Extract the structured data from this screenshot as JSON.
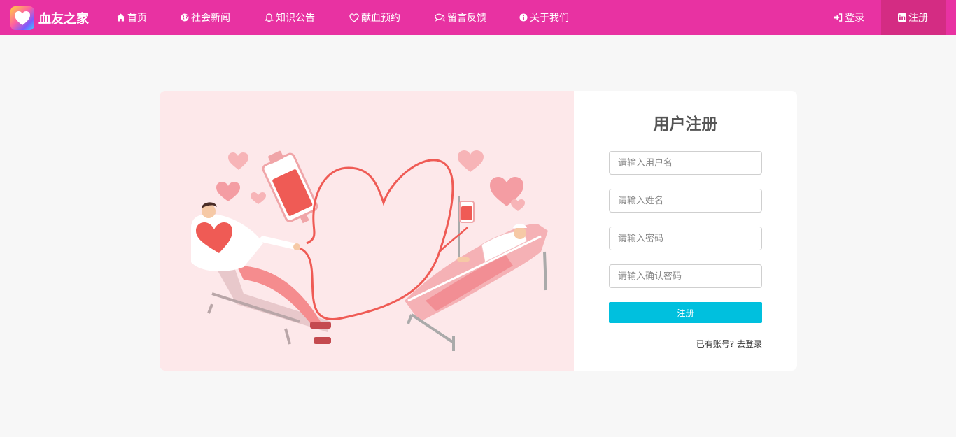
{
  "nav": {
    "brand": "血友之家",
    "items": [
      {
        "label": "首页",
        "icon": "home-icon"
      },
      {
        "label": "社会新闻",
        "icon": "globe-icon"
      },
      {
        "label": "知识公告",
        "icon": "bell-icon"
      },
      {
        "label": "献血预约",
        "icon": "heart-icon"
      },
      {
        "label": "留言反馈",
        "icon": "comments-icon"
      },
      {
        "label": "关于我们",
        "icon": "info-circle-icon"
      }
    ],
    "login": {
      "label": "登录",
      "icon": "sign-in-icon"
    },
    "register": {
      "label": "注册",
      "icon": "linkedin-icon"
    }
  },
  "form": {
    "title": "用户注册",
    "username_placeholder": "请输入用户名",
    "name_placeholder": "请输入姓名",
    "password_placeholder": "请输入密码",
    "confirm_placeholder": "请输入确认密码",
    "submit_label": "注册",
    "hint_prefix": "已有账号?",
    "hint_link": "去登录"
  },
  "colors": {
    "navbar": "#e832a2",
    "active_nav": "#d42c83",
    "submit": "#00c0de",
    "illustration_bg": "#fde8ea"
  }
}
